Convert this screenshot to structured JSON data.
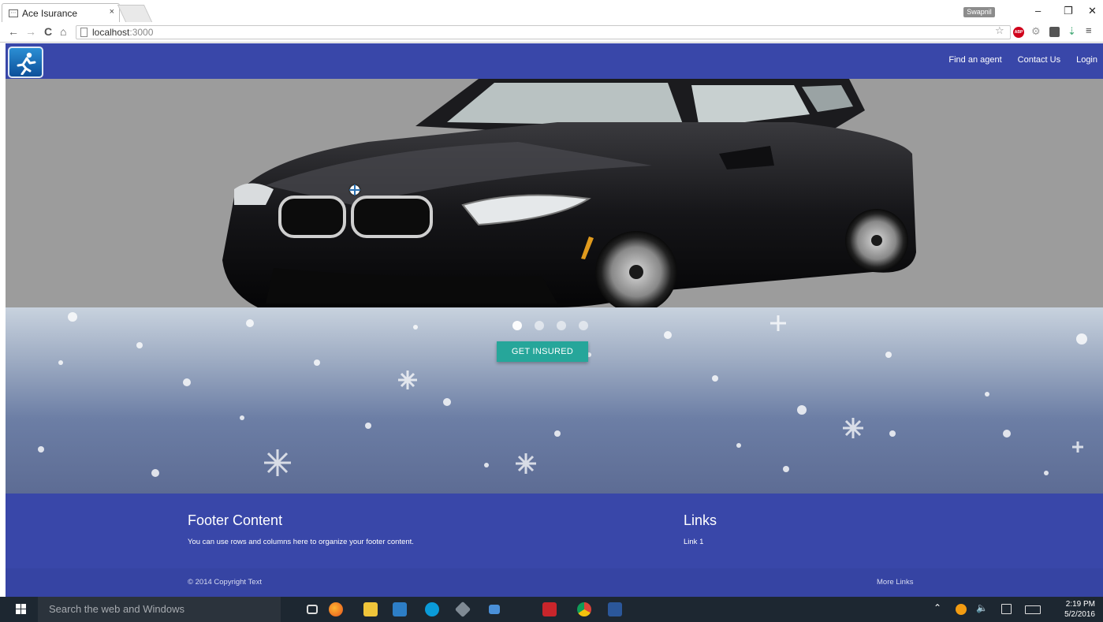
{
  "browser": {
    "tab_title": "Ace Isurance",
    "tab_close": "×",
    "profile_name": "Swapnil",
    "url_host": "localhost",
    "url_port": ":3000",
    "window_minimize": "–",
    "window_restore": "❐",
    "window_close": "✕",
    "back": "←",
    "forward": "→",
    "reload": "C",
    "home": "⌂",
    "abp_label": "ABP"
  },
  "site": {
    "nav": {
      "links": [
        "Find an agent",
        "Contact Us",
        "Login"
      ]
    },
    "carousel": {
      "indicator_count": 4,
      "active_index": 0,
      "cta_label": "GET INSURED"
    },
    "footer": {
      "heading": "Footer Content",
      "text": "You can use rows and columns here to organize your footer content.",
      "links_heading": "Links",
      "link1": "Link 1",
      "copyright": "© 2014 Copyright Text",
      "more_links": "More Links"
    }
  },
  "taskbar": {
    "search_placeholder": "Search the web and Windows",
    "time": "2:19 PM",
    "date": "5/2/2016"
  },
  "colors": {
    "primary": "#3947a9",
    "accent": "#26a69a"
  }
}
